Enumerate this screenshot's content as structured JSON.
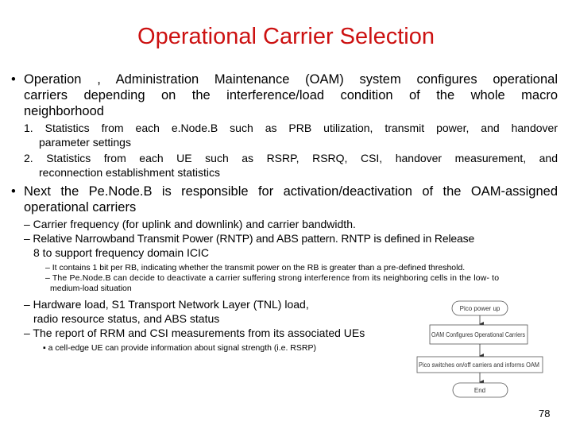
{
  "slide": {
    "title": "Operational Carrier Selection",
    "page_number": "78",
    "title_color": "#cc1111"
  },
  "bullets": {
    "b1": {
      "marker": "•",
      "line1": "Operation , Administration Maintenance (OAM) system configures operational",
      "line2": "carriers depending on the interference/load condition of the whole macro",
      "line3": "neighborhood",
      "sub": [
        {
          "line1": "1. Statistics from each e.Node.B such as PRB utilization, transmit power, and handover",
          "line2": "parameter settings"
        },
        {
          "line1": "2. Statistics from each UE such as RSRP, RSRQ, CSI, handover measurement, and",
          "line2": "reconnection establishment statistics"
        }
      ]
    },
    "b2": {
      "marker": "•",
      "line1": "Next the Pe.Node.B is responsible for activation/deactivation of the OAM-assigned",
      "line2": "operational carriers",
      "sub": [
        {
          "line1": "– Carrier frequency (for uplink and downlink) and carrier bandwidth."
        },
        {
          "line1": "– Relative Narrowband Transmit Power (RNTP) and ABS pattern. RNTP is defined in Release",
          "line2": "8 to support frequency domain ICIC"
        },
        {
          "line1": "– Hardware load, S1 Transport Network Layer (TNL) load,",
          "line2": "radio resource status, and ABS status"
        },
        {
          "line1": "– The report of RRM and CSI measurements from its associated UEs"
        }
      ],
      "subsub_rntp": [
        {
          "line1": "– It contains 1 bit per RB, indicating whether the transmit power on the RB is greater than a pre-defined threshold."
        },
        {
          "line1": "– The Pe.Node.B can decide to deactivate a carrier suffering strong interference from its neighboring cells in the low- to",
          "line2": "medium-load situation"
        }
      ],
      "subsub_rrm": [
        {
          "line1": "▪ a cell-edge UE can provide information about signal strength (i.e. RSRP)"
        }
      ]
    }
  },
  "flowchart": {
    "nodes": [
      {
        "shape": "terminal",
        "label": "Pico power up"
      },
      {
        "shape": "process",
        "label": "OAM Configures Operational Carriers"
      },
      {
        "shape": "process",
        "label": "Pico switches on/off carriers and informs OAM"
      },
      {
        "shape": "terminal",
        "label": "End"
      }
    ]
  }
}
